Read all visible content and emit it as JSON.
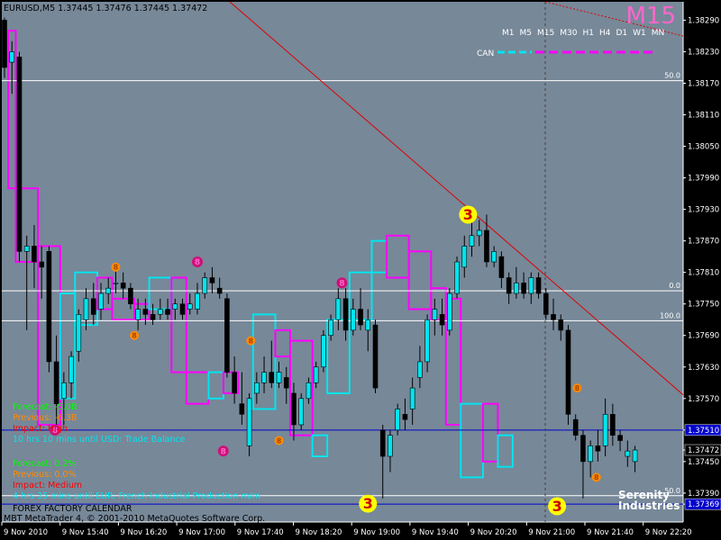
{
  "header": {
    "symbol_info": "EURUSD,M5  1.37445  1.37476  1.37445  1.37472"
  },
  "timeframe_overlay": {
    "big_label": "M15",
    "buttons": [
      "M1",
      "M5",
      "M15",
      "M30",
      "H1",
      "H4",
      "D1",
      "W1",
      "MN"
    ],
    "can_label": "CAN"
  },
  "news": [
    {
      "forecast": "Forecast: -5.0B",
      "previous": "Previous: -6.3B",
      "impact": "Impact: High",
      "countdown": "10 hrs 10 mins until USD: Trade Balance"
    },
    {
      "forecast": "Forecast: 0.2%",
      "previous": "Previous: 0.0%",
      "impact": "Impact: Medium",
      "countdown": "4 hrs 35 mins until EUR: French Industrial Production m/m"
    }
  ],
  "footer": {
    "calendar": "FOREX FACTORY CALENDAR",
    "copyright": "MBT MetaTrader 4, © 2001-2010 MetaQuotes Software Corp."
  },
  "brand": {
    "line1": "Serenity",
    "line2": "Industries"
  },
  "colors": {
    "plot_bg": "#778899",
    "bull": "#00e5ee",
    "bear": "#000000",
    "box_magenta": "#ff00ff",
    "box_cyan": "#00e5ee",
    "level_line": "#ffffff",
    "blue_line": "#0000cc",
    "trend_line": "#dd0000",
    "marker_yellow": "#ffff00",
    "marker_orange": "#ff8c00",
    "marker_magenta": "#cc1177",
    "news_forecast": "#00ff00",
    "news_previous": "#ff8c00",
    "news_impact": "#ff0000",
    "news_countdown": "#00e5ee"
  },
  "chart_data": {
    "type": "candlestick",
    "symbol": "EURUSD",
    "timeframe": "M5",
    "ylim": [
      1.37335,
      1.38325
    ],
    "y_ticks": [
      "1.38290",
      "1.38230",
      "1.38170",
      "1.38110",
      "1.38050",
      "1.37990",
      "1.37930",
      "1.37870",
      "1.37810",
      "1.37750",
      "1.37690",
      "1.37630",
      "1.37570",
      "1.37510",
      "1.37472",
      "1.37450",
      "1.37390",
      "1.37369"
    ],
    "x_ticks": [
      "9 Nov 2010",
      "9 Nov 15:40",
      "9 Nov 16:20",
      "9 Nov 17:00",
      "9 Nov 17:40",
      "9 Nov 18:20",
      "9 Nov 19:00",
      "9 Nov 19:40",
      "9 Nov 20:20",
      "9 Nov 21:00",
      "9 Nov 21:40",
      "9 Nov 22:20"
    ],
    "price_tags": [
      {
        "label": "1.37510",
        "value": 1.3751,
        "color": "#0000cc"
      },
      {
        "label": "1.37472",
        "value": 1.37472,
        "color": "#000000"
      },
      {
        "label": "1.37369",
        "value": 1.37369,
        "color": "#0000cc"
      }
    ],
    "level_lines": [
      {
        "label": "50.0",
        "value": 1.38175
      },
      {
        "label": "0.0",
        "value": 1.37775
      },
      {
        "label": "100.0",
        "value": 1.37718
      },
      {
        "label": "50.0",
        "value": 1.37385
      }
    ],
    "blue_lines": [
      1.3751,
      1.37369
    ],
    "candles": [
      [
        1.3829,
        1.38295,
        1.3818,
        1.382
      ],
      [
        1.3821,
        1.3825,
        1.3815,
        1.3823
      ],
      [
        1.3822,
        1.3823,
        1.3783,
        1.3785
      ],
      [
        1.3785,
        1.3788,
        1.377,
        1.3786
      ],
      [
        1.3786,
        1.379,
        1.3778,
        1.3783
      ],
      [
        1.3783,
        1.3786,
        1.3776,
        1.3782
      ],
      [
        1.3785,
        1.3786,
        1.3762,
        1.3764
      ],
      [
        1.3764,
        1.3769,
        1.3752,
        1.3756
      ],
      [
        1.3757,
        1.3762,
        1.3752,
        1.376
      ],
      [
        1.376,
        1.3766,
        1.3757,
        1.3765
      ],
      [
        1.3766,
        1.3774,
        1.3764,
        1.3773
      ],
      [
        1.3772,
        1.3778,
        1.377,
        1.3776
      ],
      [
        1.3776,
        1.3779,
        1.3771,
        1.3773
      ],
      [
        1.3774,
        1.3779,
        1.3772,
        1.3777
      ],
      [
        1.3777,
        1.378,
        1.3775,
        1.3778
      ],
      [
        1.3779,
        1.3782,
        1.3777,
        1.3779
      ],
      [
        1.3779,
        1.3781,
        1.3776,
        1.3778
      ],
      [
        1.3778,
        1.3779,
        1.3774,
        1.3775
      ],
      [
        1.3772,
        1.3776,
        1.377,
        1.3774
      ],
      [
        1.3774,
        1.3776,
        1.3771,
        1.3773
      ],
      [
        1.3773,
        1.3775,
        1.3771,
        1.3772
      ],
      [
        1.3773,
        1.3776,
        1.3772,
        1.3774
      ],
      [
        1.3774,
        1.3776,
        1.3772,
        1.3773
      ],
      [
        1.3774,
        1.3776,
        1.3772,
        1.3775
      ],
      [
        1.3775,
        1.3776,
        1.3772,
        1.3773
      ],
      [
        1.3774,
        1.3777,
        1.3773,
        1.3775
      ],
      [
        1.3774,
        1.3779,
        1.3773,
        1.3777
      ],
      [
        1.3777,
        1.3781,
        1.3776,
        1.378
      ],
      [
        1.378,
        1.3782,
        1.3777,
        1.3779
      ],
      [
        1.3778,
        1.378,
        1.3776,
        1.3777
      ],
      [
        1.3776,
        1.3777,
        1.3761,
        1.3762
      ],
      [
        1.3762,
        1.3765,
        1.3756,
        1.3758
      ],
      [
        1.3756,
        1.3762,
        1.3752,
        1.3754
      ],
      [
        1.3748,
        1.3758,
        1.3746,
        1.3757
      ],
      [
        1.3758,
        1.3762,
        1.3756,
        1.376
      ],
      [
        1.376,
        1.3765,
        1.3758,
        1.3762
      ],
      [
        1.3762,
        1.3768,
        1.3759,
        1.376
      ],
      [
        1.376,
        1.3764,
        1.3759,
        1.3762
      ],
      [
        1.3761,
        1.3763,
        1.3756,
        1.3759
      ],
      [
        1.3758,
        1.376,
        1.3749,
        1.3752
      ],
      [
        1.3752,
        1.3758,
        1.3751,
        1.3757
      ],
      [
        1.3757,
        1.3761,
        1.3756,
        1.376
      ],
      [
        1.376,
        1.3764,
        1.3759,
        1.3763
      ],
      [
        1.3763,
        1.377,
        1.3762,
        1.3769
      ],
      [
        1.3769,
        1.3773,
        1.3768,
        1.3772
      ],
      [
        1.3772,
        1.3778,
        1.377,
        1.3776
      ],
      [
        1.3776,
        1.3778,
        1.3768,
        1.377
      ],
      [
        1.377,
        1.3776,
        1.3769,
        1.3774
      ],
      [
        1.3774,
        1.3778,
        1.377,
        1.3771
      ],
      [
        1.377,
        1.3774,
        1.3766,
        1.3772
      ],
      [
        1.3771,
        1.3772,
        1.3758,
        1.3759
      ],
      [
        1.3751,
        1.3752,
        1.3738,
        1.3746
      ],
      [
        1.3746,
        1.3751,
        1.3743,
        1.375
      ],
      [
        1.3751,
        1.3756,
        1.375,
        1.3755
      ],
      [
        1.3754,
        1.3757,
        1.3751,
        1.3753
      ],
      [
        1.3755,
        1.3761,
        1.3752,
        1.3759
      ],
      [
        1.3761,
        1.3767,
        1.3759,
        1.3764
      ],
      [
        1.3764,
        1.3773,
        1.3762,
        1.3772
      ],
      [
        1.3772,
        1.3776,
        1.3769,
        1.3774
      ],
      [
        1.3773,
        1.3776,
        1.3769,
        1.3771
      ],
      [
        1.377,
        1.3778,
        1.3769,
        1.3777
      ],
      [
        1.3777,
        1.3784,
        1.3776,
        1.3783
      ],
      [
        1.3782,
        1.3788,
        1.378,
        1.3786
      ],
      [
        1.3786,
        1.3792,
        1.3784,
        1.3788
      ],
      [
        1.3788,
        1.3791,
        1.3786,
        1.3789
      ],
      [
        1.3789,
        1.3792,
        1.3782,
        1.3783
      ],
      [
        1.3783,
        1.3786,
        1.3782,
        1.3785
      ],
      [
        1.3784,
        1.3785,
        1.3778,
        1.378
      ],
      [
        1.378,
        1.3781,
        1.3775,
        1.3777
      ],
      [
        1.3777,
        1.3782,
        1.3776,
        1.3779
      ],
      [
        1.3779,
        1.3781,
        1.3776,
        1.3777
      ],
      [
        1.3777,
        1.3781,
        1.3775,
        1.378
      ],
      [
        1.378,
        1.3781,
        1.3776,
        1.3777
      ],
      [
        1.3777,
        1.3778,
        1.3772,
        1.3773
      ],
      [
        1.3773,
        1.3776,
        1.377,
        1.3772
      ],
      [
        1.3772,
        1.3773,
        1.3768,
        1.377
      ],
      [
        1.377,
        1.3771,
        1.3752,
        1.3754
      ],
      [
        1.3753,
        1.3754,
        1.3749,
        1.375
      ],
      [
        1.375,
        1.3751,
        1.3738,
        1.3745
      ],
      [
        1.3745,
        1.3749,
        1.3742,
        1.3748
      ],
      [
        1.3748,
        1.3751,
        1.3745,
        1.3747
      ],
      [
        1.3748,
        1.3757,
        1.3746,
        1.3754
      ],
      [
        1.3754,
        1.3756,
        1.3748,
        1.375
      ],
      [
        1.375,
        1.3751,
        1.3747,
        1.3749
      ],
      [
        1.3746,
        1.3749,
        1.3744,
        1.3747
      ],
      [
        1.3745,
        1.3748,
        1.3743,
        1.37472
      ]
    ],
    "session_boxes": [
      {
        "color": "magenta",
        "start": 1,
        "end": 2,
        "top": 1.3827,
        "bottom": 1.3797
      },
      {
        "color": "magenta",
        "start": 2,
        "end": 5,
        "top": 1.3797,
        "bottom": 1.3783
      },
      {
        "color": "magenta",
        "start": 5,
        "end": 8,
        "top": 1.3786,
        "bottom": 1.3752
      },
      {
        "color": "cyan",
        "start": 8,
        "end": 10,
        "top": 1.3777,
        "bottom": 1.3757
      },
      {
        "color": "cyan",
        "start": 10,
        "end": 13,
        "top": 1.3781,
        "bottom": 1.3771
      },
      {
        "color": "magenta",
        "start": 13,
        "end": 15,
        "top": 1.378,
        "bottom": 1.3774
      },
      {
        "color": "magenta",
        "start": 15,
        "end": 18,
        "top": 1.3776,
        "bottom": 1.3772
      },
      {
        "color": "magenta",
        "start": 18,
        "end": 20,
        "top": 1.3775,
        "bottom": 1.3772
      },
      {
        "color": "cyan",
        "start": 20,
        "end": 23,
        "top": 1.378,
        "bottom": 1.3774
      },
      {
        "color": "magenta",
        "start": 23,
        "end": 25,
        "top": 1.378,
        "bottom": 1.3762
      },
      {
        "color": "magenta",
        "start": 25,
        "end": 28,
        "top": 1.3762,
        "bottom": 1.3756
      },
      {
        "color": "cyan",
        "start": 28,
        "end": 30,
        "top": 1.3762,
        "bottom": 1.3757
      },
      {
        "color": "magenta",
        "start": 30,
        "end": 32,
        "top": 1.3762,
        "bottom": 1.3758
      },
      {
        "color": "cyan",
        "start": 34,
        "end": 37,
        "top": 1.3773,
        "bottom": 1.3755
      },
      {
        "color": "magenta",
        "start": 37,
        "end": 39,
        "top": 1.377,
        "bottom": 1.3765
      },
      {
        "color": "magenta",
        "start": 39,
        "end": 42,
        "top": 1.3768,
        "bottom": 1.375
      },
      {
        "color": "cyan",
        "start": 42,
        "end": 44,
        "top": 1.375,
        "bottom": 1.3746
      },
      {
        "color": "cyan",
        "start": 44,
        "end": 47,
        "top": 1.3772,
        "bottom": 1.3758
      },
      {
        "color": "cyan",
        "start": 47,
        "end": 50,
        "top": 1.3781,
        "bottom": 1.3772
      },
      {
        "color": "cyan",
        "start": 50,
        "end": 52,
        "top": 1.3787,
        "bottom": 1.3781
      },
      {
        "color": "magenta",
        "start": 52,
        "end": 55,
        "top": 1.3788,
        "bottom": 1.378
      },
      {
        "color": "magenta",
        "start": 55,
        "end": 58,
        "top": 1.3785,
        "bottom": 1.3774
      },
      {
        "color": "magenta",
        "start": 58,
        "end": 60,
        "top": 1.3778,
        "bottom": 1.3772
      },
      {
        "color": "magenta",
        "start": 60,
        "end": 62,
        "top": 1.3776,
        "bottom": 1.3752
      },
      {
        "color": "cyan",
        "start": 62,
        "end": 65,
        "top": 1.3756,
        "bottom": 1.3742
      },
      {
        "color": "magenta",
        "start": 65,
        "end": 67,
        "top": 1.3756,
        "bottom": 1.3745
      },
      {
        "color": "cyan",
        "start": 67,
        "end": 69,
        "top": 1.375,
        "bottom": 1.3744
      }
    ],
    "trend_line": {
      "from": [
        0,
        1.384
      ],
      "to": [
        86,
        1.3756
      ]
    },
    "bubbles": [
      {
        "label": "3",
        "type": "yellow",
        "index": 62.5,
        "price": 1.3792
      },
      {
        "label": "3",
        "type": "yellow",
        "index": 49,
        "price": 1.3737
      },
      {
        "label": "3",
        "type": "yellow",
        "index": 74.5,
        "price": 1.37365
      },
      {
        "label": "8",
        "type": "magenta",
        "index": 26,
        "price": 1.3783
      },
      {
        "label": "8",
        "type": "magenta",
        "index": 45.5,
        "price": 1.3779
      },
      {
        "label": "8",
        "type": "magenta",
        "index": 29.5,
        "price": 1.3747
      },
      {
        "label": "8",
        "type": "magenta",
        "index": 6.8,
        "price": 1.3751
      },
      {
        "label": "8",
        "type": "orange",
        "index": 15,
        "price": 1.3782
      },
      {
        "label": "8",
        "type": "orange",
        "index": 17.5,
        "price": 1.3769
      },
      {
        "label": "8",
        "type": "orange",
        "index": 33.2,
        "price": 1.3768
      },
      {
        "label": "8",
        "type": "orange",
        "index": 37,
        "price": 1.3749
      },
      {
        "label": "8",
        "type": "orange",
        "index": 77.2,
        "price": 1.3759
      },
      {
        "label": "8",
        "type": "orange",
        "index": 79.8,
        "price": 1.3742
      }
    ],
    "dashed_vertical_at_index": 72.9
  }
}
